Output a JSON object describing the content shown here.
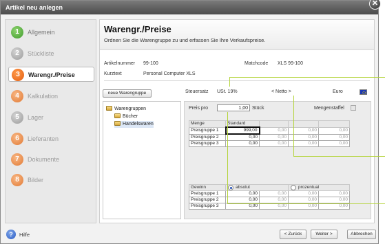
{
  "window": {
    "title": "Artikel neu anlegen",
    "close_glyph": "✕"
  },
  "sidebar": {
    "items": [
      {
        "num": "1",
        "label": "Allgemein",
        "state": "done"
      },
      {
        "num": "2",
        "label": "Stückliste",
        "state": "grey"
      },
      {
        "num": "3",
        "label": "Warengr./Preise",
        "state": "active"
      },
      {
        "num": "4",
        "label": "Kalkulation",
        "state": "orange"
      },
      {
        "num": "5",
        "label": "Lager",
        "state": "grey"
      },
      {
        "num": "6",
        "label": "Lieferanten",
        "state": "orange"
      },
      {
        "num": "7",
        "label": "Dokumente",
        "state": "orange"
      },
      {
        "num": "8",
        "label": "Bilder",
        "state": "orange"
      }
    ]
  },
  "header": {
    "title": "Warengr./Preise",
    "subtitle": "Ordnen Sie die Warengruppe zu und erfassen Sie Ihre Verkaufspreise."
  },
  "info": {
    "artikelnummer_label": "Artikelnummer",
    "artikelnummer": "99-100",
    "matchcode_label": "Matchcode",
    "matchcode": "XLS 99-100",
    "kurztext_label": "Kurztext",
    "kurztext": "Personal Computer XLS"
  },
  "warengruppe": {
    "new_button": "neue Warengruppe",
    "tree": [
      {
        "label": "Warengruppen",
        "level": 0,
        "selected": false
      },
      {
        "label": "Bücher",
        "level": 1,
        "selected": false
      },
      {
        "label": "Handelswaren",
        "level": 1,
        "selected": true
      }
    ]
  },
  "prices": {
    "steuersatz_label": "Steuersatz",
    "steuersatz": "USt. 19%",
    "netto_toggle": "< Netto >",
    "currency": "Euro",
    "preis_pro_label": "Preis pro",
    "preis_pro_value": "1,00",
    "unit": "Stück",
    "mengenstaffel_label": "Mengenstaffel",
    "table_headers": [
      "Menge",
      "Standard",
      "",
      "",
      ""
    ],
    "rows": [
      {
        "label": "Preisgruppe 1",
        "values": [
          "999,00",
          "0,00",
          "0,00",
          "0,00"
        ]
      },
      {
        "label": "Preisgruppe 2",
        "values": [
          "0,00",
          "0,00",
          "0,00",
          "0,00"
        ]
      },
      {
        "label": "Preisgruppe 3",
        "values": [
          "0,00",
          "0,00",
          "0,00",
          "0,00"
        ]
      }
    ],
    "gewinn_label": "Gewinn",
    "radio_absolut": "absolut",
    "radio_prozentual": "prozentual",
    "gewinn_rows": [
      {
        "label": "Preisgruppe 1",
        "values": [
          "0,00",
          "0,00",
          "0,00",
          "0,00"
        ]
      },
      {
        "label": "Preisgruppe 2",
        "values": [
          "0,00",
          "0,00",
          "0,00",
          "0,00"
        ]
      },
      {
        "label": "Preisgruppe 3",
        "values": [
          "0,00",
          "0,00",
          "0,00",
          "0,00"
        ]
      }
    ]
  },
  "footer": {
    "help": "Hilfe",
    "help_glyph": "?",
    "back": "< Zurück",
    "next": "Weiter >",
    "cancel": "Abbrechen"
  },
  "colors": {
    "active_step": "#e35d10",
    "done_step": "#3f9a2b",
    "callout": "#b4d43a",
    "flag": "#1d39b5"
  }
}
